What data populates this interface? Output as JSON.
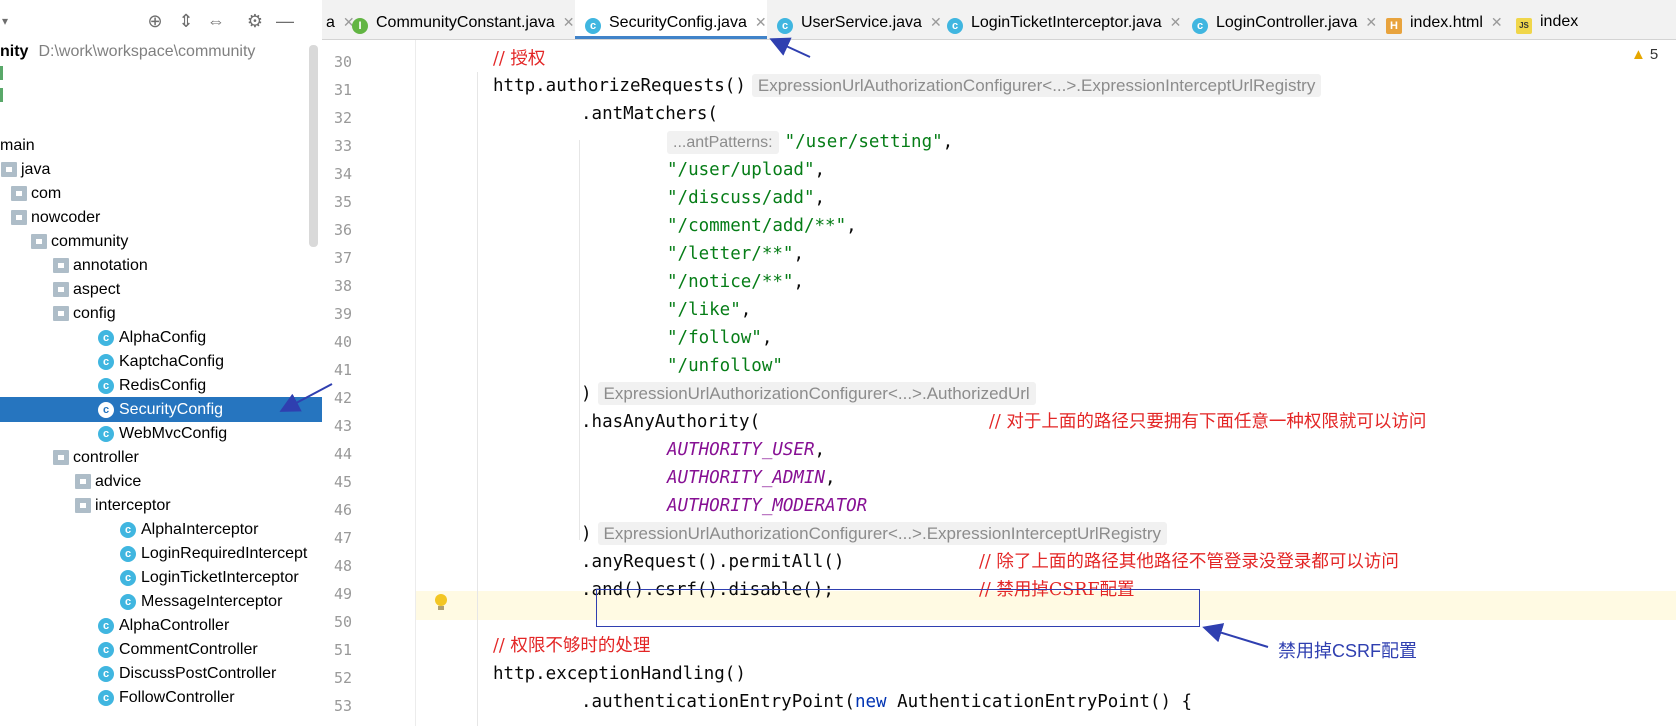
{
  "project": {
    "root_name": "nity",
    "root_path": "D:\\work\\workspace\\community",
    "tree": [
      {
        "label": "main",
        "kind": "text"
      },
      {
        "label": "java",
        "kind": "folder"
      },
      {
        "label": "com",
        "kind": "folder"
      },
      {
        "label": "nowcoder",
        "kind": "folder",
        "expanded": true
      },
      {
        "label": "community",
        "kind": "folder",
        "expanded": true
      },
      {
        "label": "annotation",
        "kind": "folder",
        "expanded": false
      },
      {
        "label": "aspect",
        "kind": "folder",
        "expanded": false
      },
      {
        "label": "config",
        "kind": "folder",
        "expanded": true
      },
      {
        "label": "AlphaConfig",
        "kind": "class"
      },
      {
        "label": "KaptchaConfig",
        "kind": "class"
      },
      {
        "label": "RedisConfig",
        "kind": "class"
      },
      {
        "label": "SecurityConfig",
        "kind": "class",
        "selected": true
      },
      {
        "label": "WebMvcConfig",
        "kind": "class"
      },
      {
        "label": "controller",
        "kind": "folder",
        "expanded": true
      },
      {
        "label": "advice",
        "kind": "folder",
        "expanded": false
      },
      {
        "label": "interceptor",
        "kind": "folder",
        "expanded": true
      },
      {
        "label": "AlphaInterceptor",
        "kind": "class"
      },
      {
        "label": "LoginRequiredIntercept",
        "kind": "class"
      },
      {
        "label": "LoginTicketInterceptor",
        "kind": "class"
      },
      {
        "label": "MessageInterceptor",
        "kind": "class"
      },
      {
        "label": "AlphaController",
        "kind": "class"
      },
      {
        "label": "CommentController",
        "kind": "class"
      },
      {
        "label": "DiscussPostController",
        "kind": "class"
      },
      {
        "label": "FollowController",
        "kind": "class"
      }
    ]
  },
  "tabs": [
    {
      "label": "a",
      "icon": "none"
    },
    {
      "label": "CommunityConstant.java",
      "icon": "interface-icon"
    },
    {
      "label": "SecurityConfig.java",
      "icon": "class-icon",
      "active": true
    },
    {
      "label": "UserService.java",
      "icon": "class-icon"
    },
    {
      "label": "LoginTicketInterceptor.java",
      "icon": "class-icon"
    },
    {
      "label": "LoginController.java",
      "icon": "class-icon"
    },
    {
      "label": "index.html",
      "icon": "html-icon"
    },
    {
      "label": "index",
      "icon": "js-icon"
    }
  ],
  "editor": {
    "warning_count": "5",
    "line_numbers": [
      "30",
      "31",
      "32",
      "33",
      "34",
      "35",
      "36",
      "37",
      "38",
      "39",
      "40",
      "41",
      "42",
      "43",
      "44",
      "45",
      "46",
      "47",
      "48",
      "49",
      "50",
      "51",
      "52",
      "53"
    ],
    "code": {
      "l30": "// 授权",
      "l31_code": "http.authorizeRequests()",
      "l31_hint": "ExpressionUrlAuthorizationConfigurer<...>.ExpressionInterceptUrlRegistry",
      "l32": ".antMatchers(",
      "l33_hint": "...antPatterns:",
      "l33_str": "\"/user/setting\"",
      "l34": "\"/user/upload\"",
      "l35": "\"/discuss/add\"",
      "l36": "\"/comment/add/**\"",
      "l37": "\"/letter/**\"",
      "l38": "\"/notice/**\"",
      "l39": "\"/like\"",
      "l40": "\"/follow\"",
      "l41": "\"/unfollow\"",
      "l42_code": ")",
      "l42_hint": "ExpressionUrlAuthorizationConfigurer<...>.AuthorizedUrl",
      "l43_code": ".hasAnyAuthority(",
      "l43_comment": "// 对于上面的路径只要拥有下面任意一种权限就可以访问",
      "l44": "AUTHORITY_USER",
      "l45": "AUTHORITY_ADMIN",
      "l46": "AUTHORITY_MODERATOR",
      "l47_code": ")",
      "l47_hint": "ExpressionUrlAuthorizationConfigurer<...>.ExpressionInterceptUrlRegistry",
      "l48_code": ".anyRequest().permitAll()",
      "l48_comment": "// 除了上面的路径其他路径不管登录没登录都可以访问",
      "l49_code": ".and().csrf().disable();",
      "l49_comment": "// 禁用掉CSRF配置",
      "l51": "// 权限不够时的处理",
      "l52": "http.exceptionHandling()",
      "l53_a": ".authenticationEntryPoint(",
      "l53_kw": "new",
      "l53_b": " AuthenticationEntryPoint() {"
    }
  },
  "annotation": {
    "label": "禁用掉CSRF配置",
    "color": "#2f3fb0"
  },
  "colors": {
    "selection": "#2675bf",
    "comment": "#e32626",
    "string": "#067d17",
    "constant": "#871094",
    "active_tab_underline": "#4083c9"
  }
}
